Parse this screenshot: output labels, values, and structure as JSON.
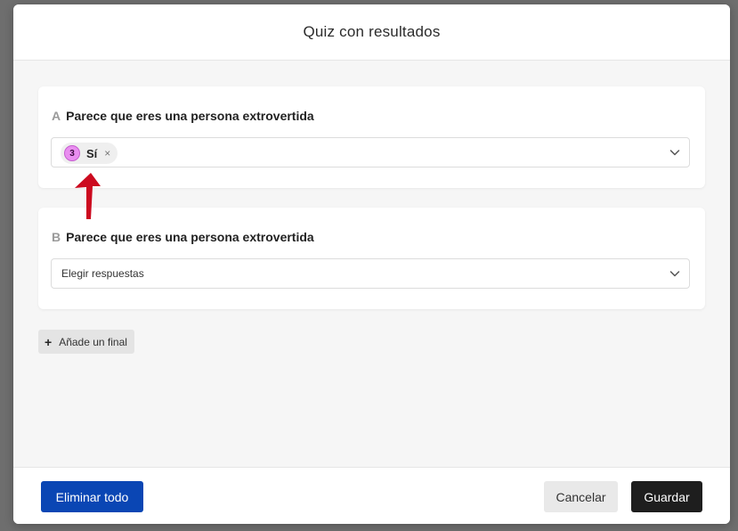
{
  "modal": {
    "title": "Quiz con resultados"
  },
  "results": [
    {
      "letter": "A",
      "title": "Parece que eres una persona extrovertida",
      "selected": {
        "badge": "3",
        "label": "Sí",
        "remove": "×"
      }
    },
    {
      "letter": "B",
      "title": "Parece que eres una persona extrovertida",
      "placeholder": "Elegir respuestas"
    }
  ],
  "add_ending": {
    "icon": "+",
    "label": "Añade un final"
  },
  "footer": {
    "delete_all": "Eliminar todo",
    "cancel": "Cancelar",
    "save": "Guardar"
  },
  "colors": {
    "primary_blue": "#0a46b4",
    "save_dark": "#1e1e1e",
    "badge_pink": "#e98ef0",
    "arrow_red": "#cc0a1f"
  },
  "icons": {
    "chevron": "chevron-down-icon",
    "annotation": "red-arrow-icon"
  }
}
